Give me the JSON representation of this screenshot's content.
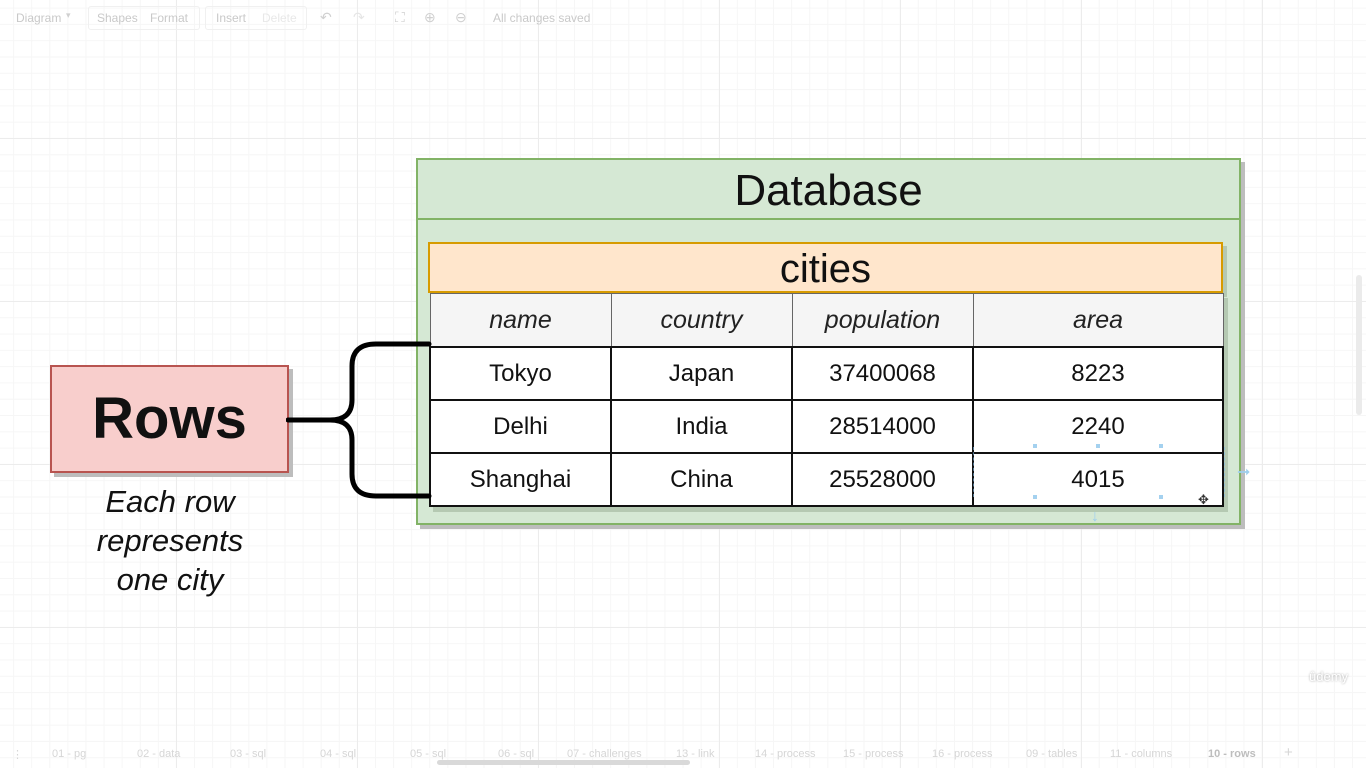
{
  "toolbar": {
    "diagram_menu": "Diagram",
    "shapes": "Shapes",
    "format": "Format",
    "insert": "Insert",
    "delete": "Delete",
    "status": "All changes saved"
  },
  "diagram": {
    "database_title": "Database",
    "table_name": "cities",
    "columns": [
      "name",
      "country",
      "population",
      "area"
    ],
    "rows": [
      [
        "Tokyo",
        "Japan",
        "37400068",
        "8223"
      ],
      [
        "Delhi",
        "India",
        "28514000",
        "2240"
      ],
      [
        "Shanghai",
        "China",
        "25528000",
        "4015"
      ]
    ],
    "rows_label": "Rows",
    "rows_caption": [
      "Each row",
      "represents",
      "one city"
    ]
  },
  "page_tabs": [
    "01 - pg",
    "02 - data",
    "03 - sql",
    "04 - sql",
    "05 - sql",
    "06 - sql",
    "07 - challenges",
    "13 - link",
    "14 - process",
    "15 - process",
    "16 - process",
    "09 - tables",
    "11 - columns",
    "10 - rows"
  ],
  "active_tab": "10 - rows",
  "watermark": "ûdemy",
  "colors": {
    "database_fill": "#d5e8d4",
    "database_stroke": "#82b366",
    "table_header_fill": "#ffe6cc",
    "table_header_stroke": "#d79b00",
    "rows_fill": "#f8cecc",
    "rows_stroke": "#b85450"
  }
}
